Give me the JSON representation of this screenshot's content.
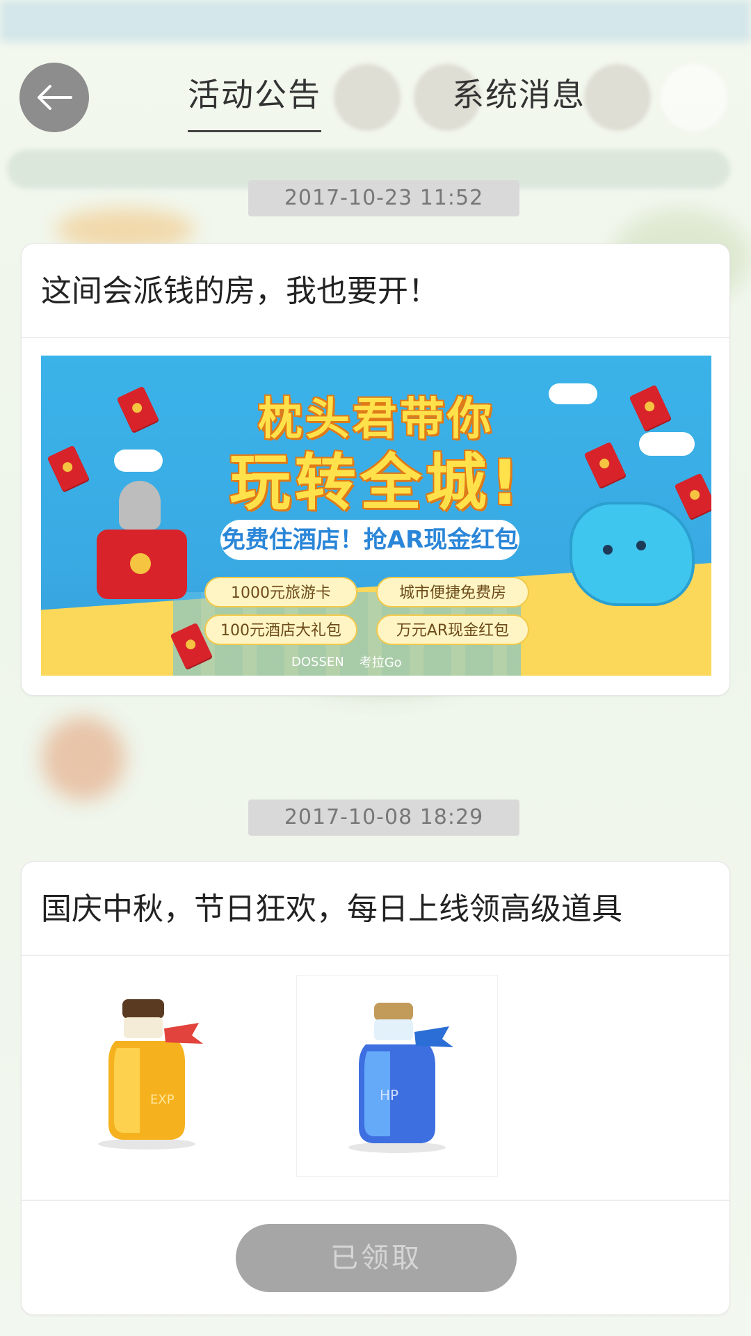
{
  "header": {
    "tabs": [
      {
        "label": "活动公告",
        "active": true
      },
      {
        "label": "系统消息",
        "active": false
      }
    ]
  },
  "announcements": [
    {
      "timestamp": "2017-10-23  11:52",
      "title": "这间会派钱的房，我也要开！",
      "banner": {
        "headline_line1": "枕头君带你",
        "headline_line2": "玩转全城!",
        "subtitle": "免费住酒店！抢AR现金红包",
        "perks": [
          "1000元旅游卡",
          "城市便捷免费房",
          "100元酒店大礼包",
          "万元AR现金红包"
        ],
        "logos": [
          "DOSSEN",
          "考拉Go"
        ]
      }
    },
    {
      "timestamp": "2017-10-08  18:29",
      "title": "国庆中秋，节日狂欢，每日上线领高级道具",
      "items": [
        {
          "icon": "exp-potion-icon",
          "label": "EXP",
          "color": "#f7b51c"
        },
        {
          "icon": "hp-potion-icon",
          "label": "HP",
          "color": "#3d6fe0"
        }
      ],
      "button_label": "已领取"
    }
  ]
}
